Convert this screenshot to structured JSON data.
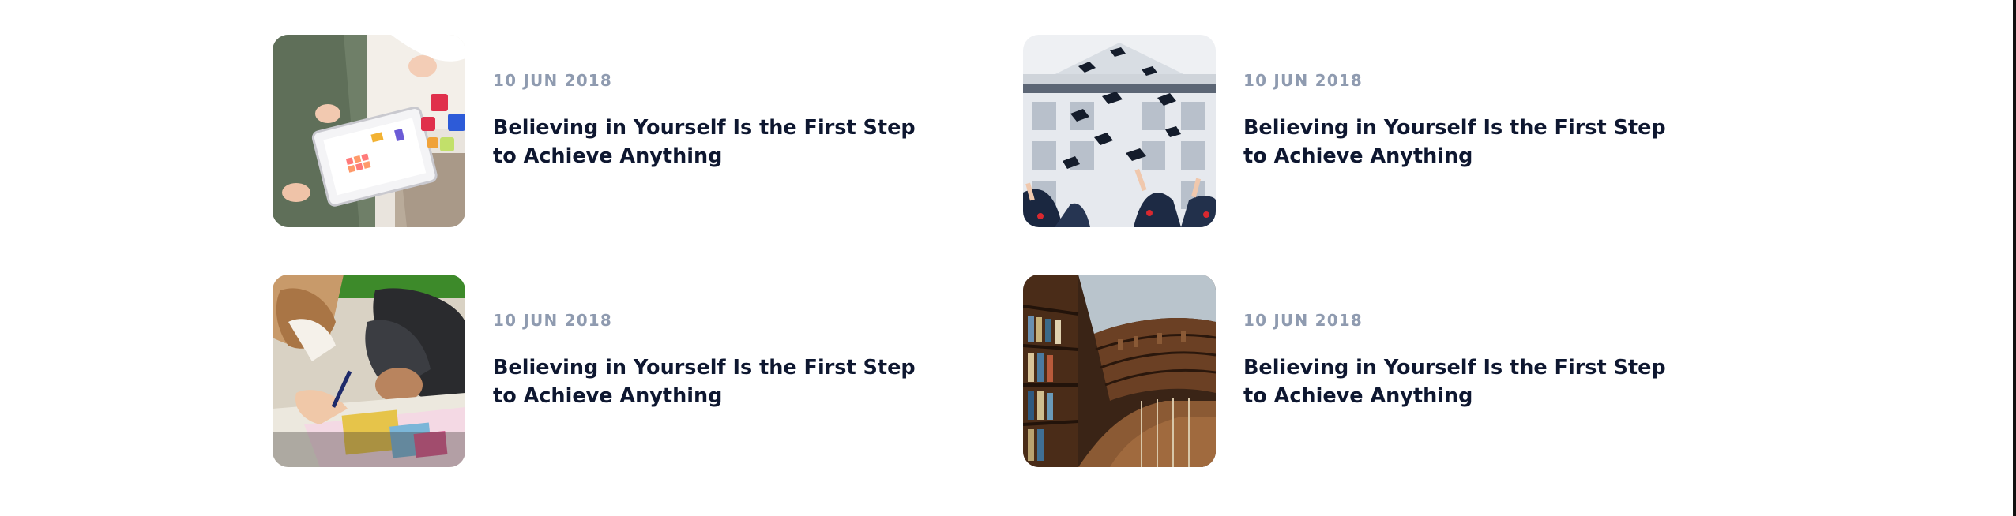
{
  "posts": [
    {
      "date": "10 JUN 2018",
      "title": "Believing in Yourself Is the First Step to Achieve Anything",
      "image": "children-tablet-toys-photo"
    },
    {
      "date": "10 JUN 2018",
      "title": "Believing in Yourself Is the First Step to Achieve Anything",
      "image": "graduation-caps-toss-photo"
    },
    {
      "date": "10 JUN 2018",
      "title": "Believing in Yourself Is the First Step to Achieve Anything",
      "image": "kids-drawing-book-photo"
    },
    {
      "date": "10 JUN 2018",
      "title": "Believing in Yourself Is the First Step to Achieve Anything",
      "image": "library-bookshelves-photo"
    }
  ],
  "colors": {
    "date": "#8f9bb0",
    "title": "#0e1730",
    "background": "#ffffff"
  }
}
